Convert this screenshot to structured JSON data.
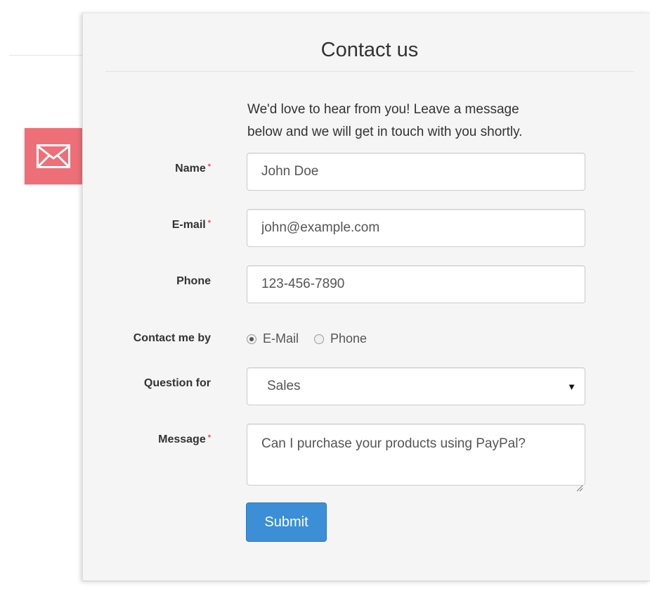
{
  "title": "Contact us",
  "intro": {
    "line1": "We'd love to hear from you! Leave a message",
    "line2": "below and we will get in touch with you shortly."
  },
  "form": {
    "required_marker": "*",
    "name": {
      "label": "Name",
      "value": "John Doe",
      "required": true
    },
    "email": {
      "label": "E-mail",
      "value": "john@example.com",
      "required": true
    },
    "phone": {
      "label": "Phone",
      "value": "123-456-7890",
      "required": false
    },
    "contact_method": {
      "label": "Contact me by",
      "options": [
        {
          "label": "E-Mail",
          "checked": true
        },
        {
          "label": "Phone",
          "checked": false
        }
      ]
    },
    "question_for": {
      "label": "Question for",
      "value": "Sales"
    },
    "message": {
      "label": "Message",
      "value": "Can I purchase your products using PayPal?",
      "required": true
    },
    "submit_label": "Submit"
  },
  "icons": {
    "mail_tab": "envelope-icon",
    "select_caret": "caret-down-icon"
  },
  "colors": {
    "mail_tab": "#ef6f78",
    "required": "#e64a5a",
    "submit": "#3c8fd6"
  }
}
